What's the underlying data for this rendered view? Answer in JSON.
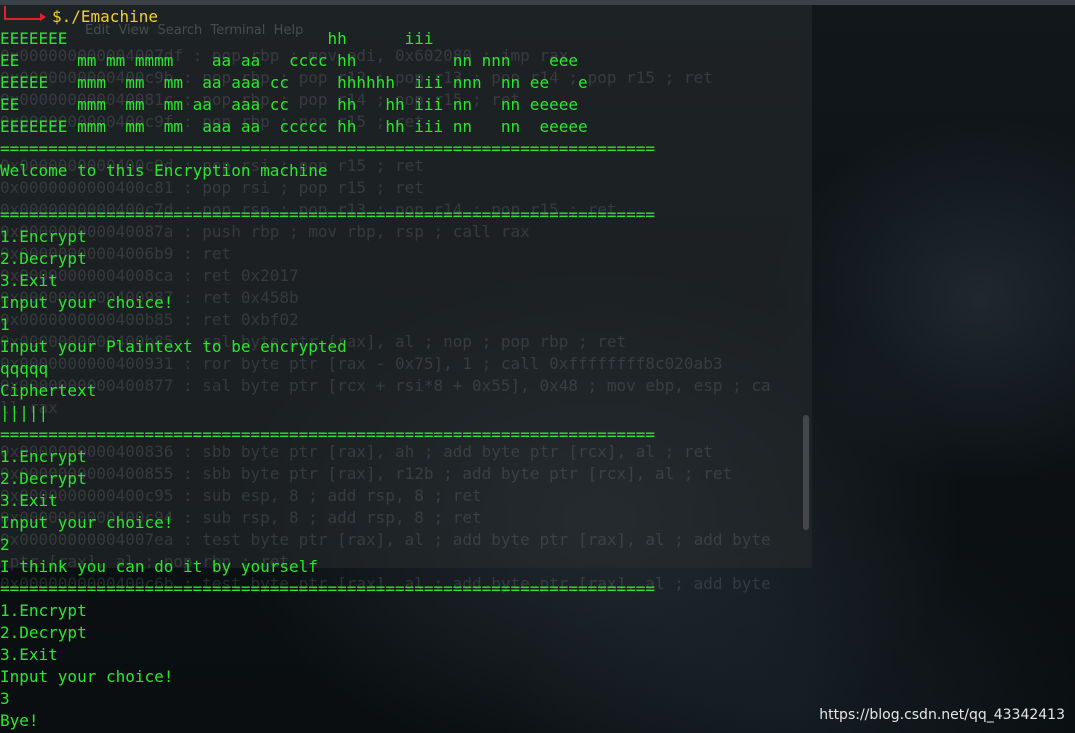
{
  "background_window": {
    "menu_text": "Edit  View  Search  Terminal  Help",
    "ghost_lines": [
      "0x000000000004007df : pop rbp ; mov edi, 0x602080 ; jmp rax",
      "0x0000000000400c9b : pop rbp ; pop r12 ; pop r13 ; pop r14 ; pop r15 ; ret",
      "0x000000000040081c : pop rbp ; pop r14 ; pop r15 ; ret",
      "0x0000000000400c9f : pop rbp ; pop r15 ; ret",
      "",
      "0x0000000000400c9d : pop rsi ; pop r15 ; ret",
      "0x0000000000400c81 : pop rsi ; pop r15 ; ret",
      "0x0000000000400c7d : pop rsp ; pop r13 ; pop r14 ; pop r15 ; ret",
      "0x000000000040087a : push rbp ; mov rbp, rsp ; call rax",
      "0x00000000004006b9 : ret",
      "0x00000000004008ca : ret 0x2017",
      "0x0000000000400987 : ret 0x458b",
      "0x0000000000400b85 : ret 0xbf02",
      "0x0000000000400b85 : sal byte ptr [rax], al ; nop ; pop rbp ; ret",
      "0x0000000000400931 : ror byte ptr [rax - 0x75], 1 ; call 0xffffffff8c020ab3",
      "0x0000000000400877 : sal byte ptr [rcx + rsi*8 + 0x55], 0x48 ; mov ebp, esp ; ca",
      "ll rax",
      "",
      "0x0000000000400836 : sbb byte ptr [rax], ah ; add byte ptr [rcx], al ; ret",
      "0x0000000000400855 : sbb byte ptr [rax], r12b ; add byte ptr [rcx], al ; ret",
      "0x0000000000400c95 : sub esp, 8 ; add rsp, 8 ; ret",
      "0x0000000000400c94 : sub rsp, 8 ; add rsp, 8 ; ret",
      "0x00000000004007ea : test byte ptr [rax], al ; add byte ptr [rax], al ; add byte",
      " ptr [rax], al ; pop rbp ; ret",
      "0x0000000000400c6b : test byte ptr [rax], al ; add byte ptr [rax], al ; add byte"
    ]
  },
  "terminal": {
    "prompt_symbol": "$",
    "command": "./Emachine",
    "output_lines": [
      "EEEEEEE                           hh      iii",
      "EE      mm mm mmmm    aa aa   cccc hh          nn nnn    eee",
      "EEEEE   mmm  mm  mm  aa aaa cc     hhhhhh  iii nnn  nn ee   e",
      "EE      mmm  mm  mm aa  aaa cc     hh   hh iii nn   nn eeeee",
      "EEEEEEE mmm  mm  mm  aaa aa  ccccc hh   hh iii nn   nn  eeeee",
      "====================================================================",
      "Welcome to this Encryption machine",
      "",
      "====================================================================",
      "1.Encrypt",
      "2.Decrypt",
      "3.Exit",
      "Input your choice!",
      "1",
      "Input your Plaintext to be encrypted",
      "qqqqq",
      "Ciphertext",
      "|||||",
      "====================================================================",
      "1.Encrypt",
      "2.Decrypt",
      "3.Exit",
      "Input your choice!",
      "2",
      "I think you can do it by yourself",
      "====================================================================",
      "1.Encrypt",
      "2.Decrypt",
      "3.Exit",
      "Input your choice!",
      "3",
      "Bye!"
    ]
  },
  "watermark": "https://blog.csdn.net/qq_43342413",
  "colors": {
    "output": "#27e82d",
    "prompt": "#f2d22a",
    "prompt_corner": "#e0202a"
  }
}
